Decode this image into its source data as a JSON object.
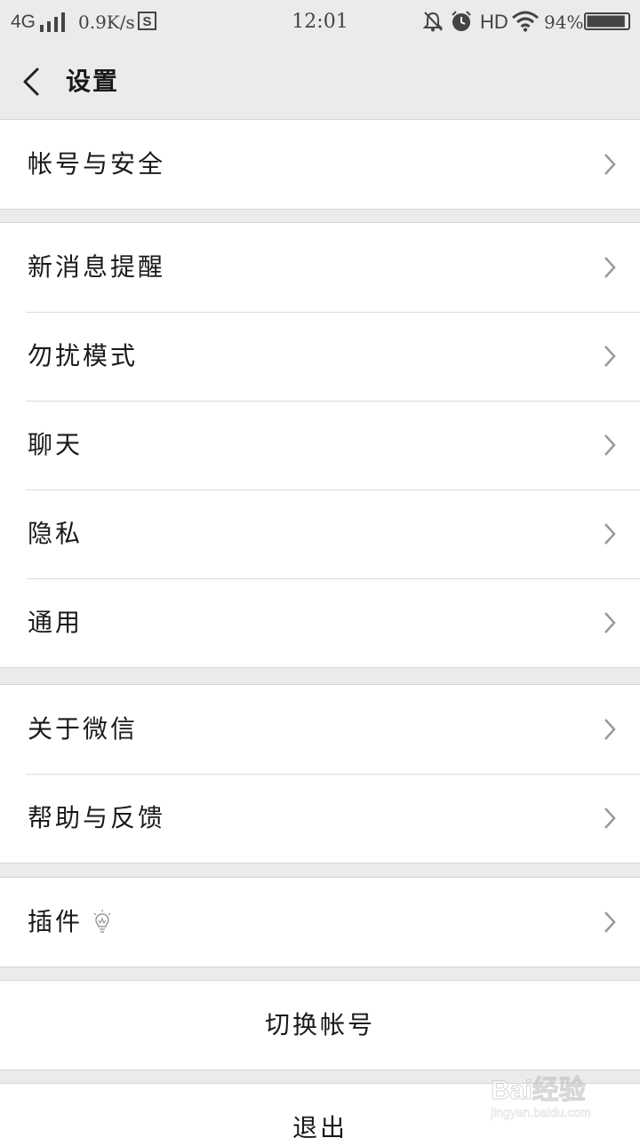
{
  "status_bar": {
    "network": "4G",
    "speed": "0.9K/s",
    "time": "12:01",
    "hd": "HD",
    "battery_text": "94%",
    "battery_level": 0.94,
    "icons": [
      "signal-icon",
      "s-app-icon",
      "mute-bell-icon",
      "alarm-icon",
      "wifi-icon",
      "battery-icon"
    ]
  },
  "header": {
    "title": "设置",
    "back_icon": "chevron-left-icon"
  },
  "groups": [
    {
      "items": [
        {
          "label": "帐号与安全"
        }
      ]
    },
    {
      "items": [
        {
          "label": "新消息提醒"
        },
        {
          "label": "勿扰模式"
        },
        {
          "label": "聊天"
        },
        {
          "label": "隐私"
        },
        {
          "label": "通用"
        }
      ]
    },
    {
      "items": [
        {
          "label": "关于微信"
        },
        {
          "label": "帮助与反馈"
        }
      ]
    },
    {
      "items": [
        {
          "label": "插件",
          "icon": "lightbulb-icon"
        }
      ]
    }
  ],
  "actions": {
    "switch_account": "切换帐号",
    "logout": "退出"
  },
  "watermark": {
    "logo": "Bai经验",
    "url": "jingyan.baidu.com"
  },
  "colors": {
    "background": "#ebebeb",
    "card": "#ffffff",
    "chevron": "#9a9a9a"
  }
}
